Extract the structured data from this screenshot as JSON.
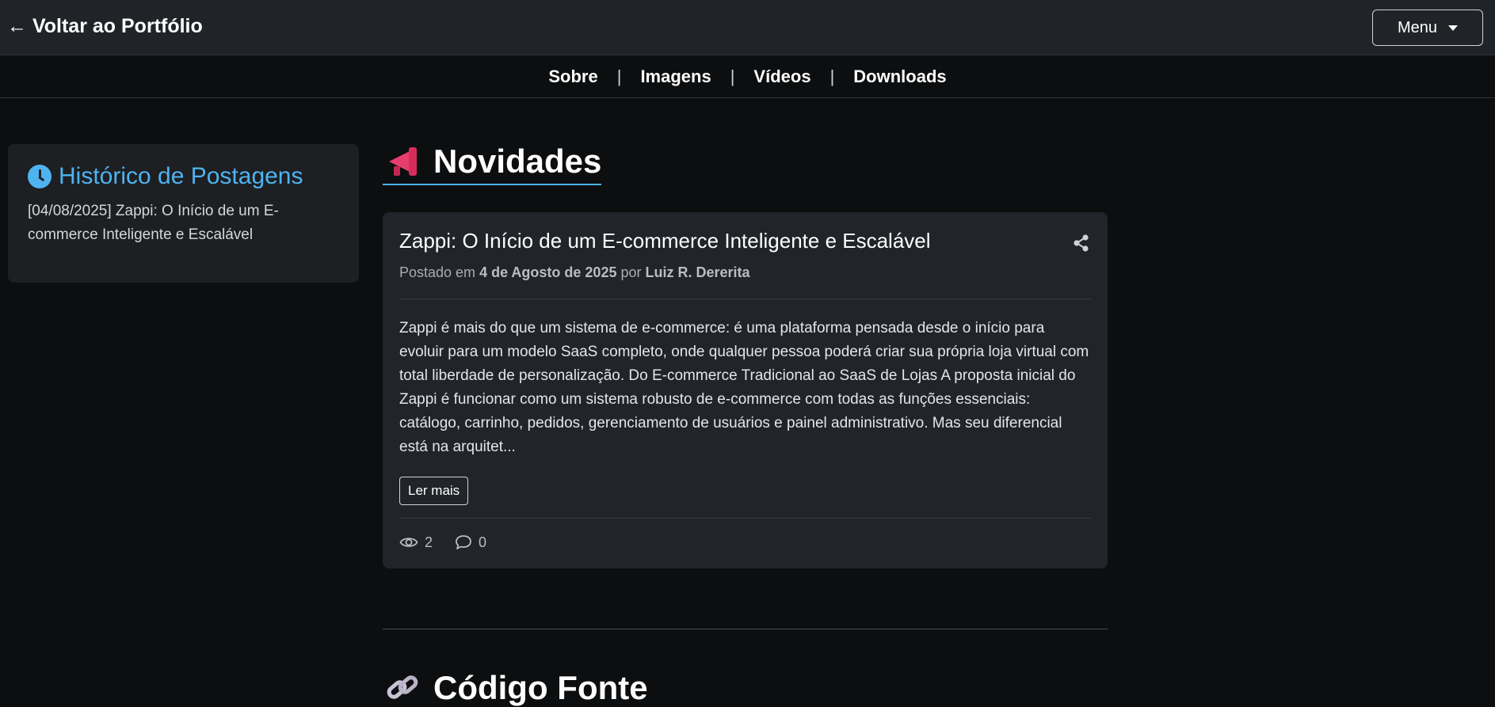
{
  "topbar": {
    "back_label": "← Voltar ao Portfólio",
    "menu_label": "Menu"
  },
  "subnav": {
    "items": [
      "Sobre",
      "Imagens",
      "Vídeos",
      "Downloads"
    ],
    "separator": "|"
  },
  "sidebar": {
    "title": "Histórico de Postagens",
    "icon": "clock-icon",
    "posts": [
      "[04/08/2025] Zappi: O Início de um E-commerce Inteligente e Escalável"
    ]
  },
  "main": {
    "section_title": "Novidades",
    "section_icon": "megaphone-icon",
    "post": {
      "title": "Zappi: O Início de um E-commerce Inteligente e Escalável",
      "meta_prefix": "Postado em",
      "date": "4 de Agosto de 2025",
      "meta_by": "por",
      "author": "Luiz R. Dererita",
      "excerpt": "Zappi é mais do que um sistema de e-commerce: é uma plataforma pensada desde o início para evoluir para um modelo SaaS completo, onde qualquer pessoa poderá criar sua própria loja virtual com total liberdade de personalização. Do E-commerce Tradicional ao SaaS de Lojas A proposta inicial do Zappi é funcionar como um sistema robusto de e-commerce com todas as funções essenciais: catálogo, carrinho, pedidos, gerenciamento de usuários e painel administrativo. Mas seu diferencial está na arquitet...",
      "read_more_label": "Ler mais",
      "views": "2",
      "comments": "0"
    },
    "second_section_title": "Código Fonte",
    "second_section_icon": "link-icon"
  },
  "colors": {
    "background": "#0d0e0f",
    "topbar": "#202327",
    "card": "#212429",
    "accent": "#4fb3f0",
    "megaphone": "#e83e6d"
  }
}
